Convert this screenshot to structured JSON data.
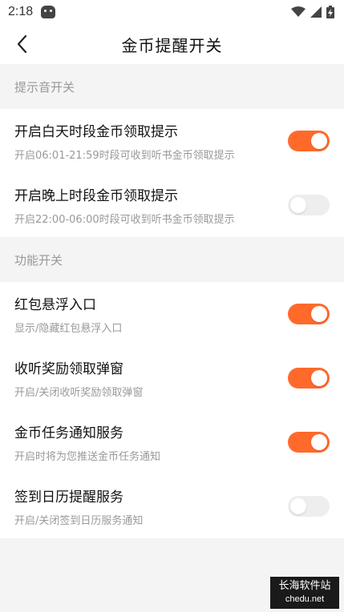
{
  "status_bar": {
    "time": "2:18",
    "icons": [
      "app-notification-icon",
      "wifi-icon",
      "signal-icon",
      "battery-charging-icon"
    ]
  },
  "header": {
    "title": "金币提醒开关",
    "back_icon": "chevron-left-icon"
  },
  "sections": [
    {
      "title": "提示音开关",
      "items": [
        {
          "title": "开启白天时段金币领取提示",
          "subtitle": "开启06:01-21:59时段可收到听书金币领取提示",
          "enabled": true
        },
        {
          "title": "开启晚上时段金币领取提示",
          "subtitle": "开启22:00-06:00时段可收到听书金币领取提示",
          "enabled": false
        }
      ]
    },
    {
      "title": "功能开关",
      "items": [
        {
          "title": "红包悬浮入口",
          "subtitle": "显示/隐藏红包悬浮入口",
          "enabled": true
        },
        {
          "title": "收听奖励领取弹窗",
          "subtitle": "开启/关闭收听奖励领取弹窗",
          "enabled": true
        },
        {
          "title": "金币任务通知服务",
          "subtitle": "开启时将为您推送金币任务通知",
          "enabled": true
        },
        {
          "title": "签到日历提醒服务",
          "subtitle": "开启/关闭签到日历服务通知",
          "enabled": false
        }
      ]
    }
  ],
  "watermark": {
    "name": "长海软件站",
    "url": "chedu.net"
  },
  "colors": {
    "accent": "#ff6a2b",
    "toggle_off": "#eeeeee",
    "background": "#f4f4f4"
  }
}
